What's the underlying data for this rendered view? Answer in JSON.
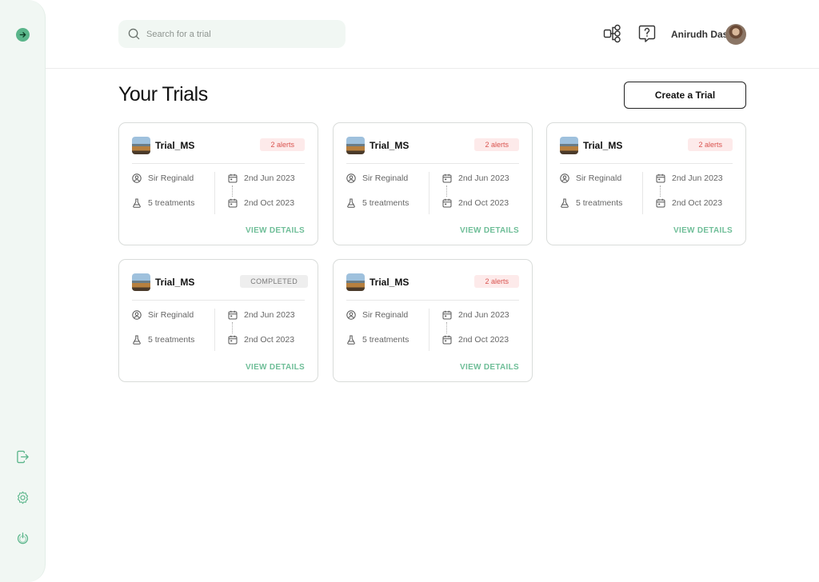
{
  "search": {
    "placeholder": "Search for a trial"
  },
  "user": {
    "name": "Anirudh Das"
  },
  "page": {
    "title": "Your Trials",
    "create_label": "Create a Trial"
  },
  "cards": [
    {
      "title": "Trial_MS",
      "badge": "2 alerts",
      "badge_type": "alert",
      "owner": "Sir Reginald",
      "treatments": "5 treatments",
      "start": "2nd Jun 2023",
      "end": "2nd Oct 2023",
      "link": "VIEW DETAILS"
    },
    {
      "title": "Trial_MS",
      "badge": "2 alerts",
      "badge_type": "alert",
      "owner": "Sir Reginald",
      "treatments": "5 treatments",
      "start": "2nd Jun 2023",
      "end": "2nd Oct 2023",
      "link": "VIEW DETAILS"
    },
    {
      "title": "Trial_MS",
      "badge": "2 alerts",
      "badge_type": "alert",
      "owner": "Sir Reginald",
      "treatments": "5 treatments",
      "start": "2nd Jun 2023",
      "end": "2nd Oct 2023",
      "link": "VIEW DETAILS"
    },
    {
      "title": "Trial_MS",
      "badge": "COMPLETED",
      "badge_type": "done",
      "owner": "Sir Reginald",
      "treatments": "5 treatments",
      "start": "2nd Jun 2023",
      "end": "2nd Oct 2023",
      "link": "VIEW DETAILS"
    },
    {
      "title": "Trial_MS",
      "badge": "2 alerts",
      "badge_type": "alert",
      "owner": "Sir Reginald",
      "treatments": "5 treatments",
      "start": "2nd Jun 2023",
      "end": "2nd Oct 2023",
      "link": "VIEW DETAILS"
    }
  ],
  "colors": {
    "accent": "#5ab58a",
    "alert": "#d9534f",
    "sidebar_bg": "#f1f7f3"
  },
  "icons": {
    "sidebar": [
      "arrow-right-icon",
      "exit-icon",
      "gear-icon",
      "power-icon"
    ],
    "header": [
      "search-icon",
      "hierarchy-icon",
      "help-chat-icon"
    ]
  }
}
